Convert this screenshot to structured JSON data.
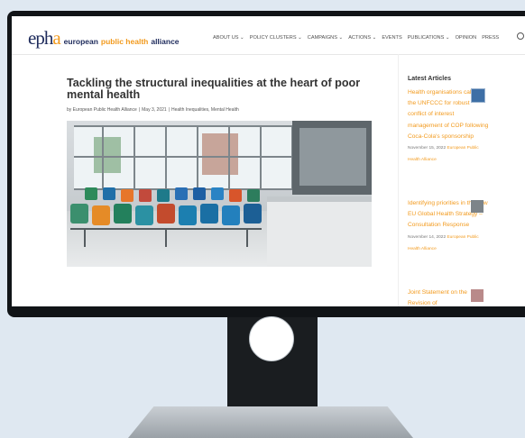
{
  "site": {
    "logo_mark": "eph",
    "logo_mark_o": "a",
    "logo_word_1": "european",
    "logo_word_2": "public health",
    "logo_word_3": "alliance",
    "brand_navy": "#1d2a5b",
    "brand_orange": "#f29a1d"
  },
  "nav": {
    "items": [
      {
        "label": "About Us ⌄"
      },
      {
        "label": "Policy Clusters ⌄"
      },
      {
        "label": "Campaigns ⌄"
      },
      {
        "label": "Actions ⌄"
      },
      {
        "label": "Events"
      },
      {
        "label": "Publications ⌄"
      },
      {
        "label": "Opinion"
      },
      {
        "label": "Press"
      }
    ],
    "search_icon": "search-icon"
  },
  "article": {
    "title": "Tackling the structural inequalities at the heart of poor mental health",
    "author": "by European Public Health Alliance",
    "date": "May 3, 2021",
    "categories": "Health Inequalities, Mental Health"
  },
  "sidebar": {
    "heading": "Latest Articles",
    "posts": [
      {
        "title": "Health organisations call on the UNFCCC for robust conflict of interest management of COP following Coca-Cola's sponsorship",
        "date": "November 15, 2022",
        "author": "European Public Health Alliance"
      },
      {
        "title": "Identifying priorities in the new EU Global Health Strategy – Consultation Response",
        "date": "November 14, 2022",
        "author": "European Public Health Alliance"
      },
      {
        "title": "Joint Statement on the Revision of",
        "date": "",
        "author": ""
      }
    ]
  }
}
